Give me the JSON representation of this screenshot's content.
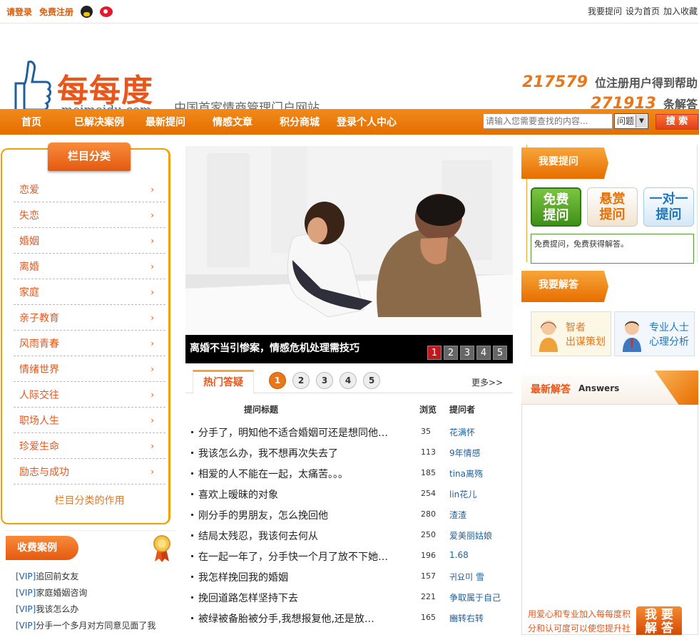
{
  "topbar": {
    "login": "请登录",
    "register": "免费注册",
    "links": [
      "我要提问",
      "设为首页",
      "加入收藏"
    ]
  },
  "header": {
    "logo_cn": "每每度",
    "logo_domain": "meimeidu.com",
    "slogan": "中国首家情商管理门户网站",
    "stat1_num": "217579",
    "stat1_label": "位注册用户得到帮助",
    "stat2_num": "271913",
    "stat2_label": "条解答"
  },
  "nav": {
    "items": [
      "首页",
      "已解决案例",
      "最新提问",
      "情感文章",
      "积分商城",
      "登录个人中心"
    ],
    "search_placeholder": "请输入您需要查找的内容...",
    "select_value": "问题",
    "search_button": "搜 索"
  },
  "sidebar": {
    "title": "栏目分类",
    "categories": [
      "恋爱",
      "失恋",
      "婚姻",
      "离婚",
      "家庭",
      "亲子教育",
      "风雨青春",
      "情绪世界",
      "人际交往",
      "职场人生",
      "珍爱生命",
      "励志与成功"
    ],
    "footer": "栏目分类的作用"
  },
  "paid": {
    "title": "收费案例",
    "items": [
      {
        "tag": "[VIP]",
        "text": "追回前女友"
      },
      {
        "tag": "[VIP]",
        "text": "家庭婚姻咨询"
      },
      {
        "tag": "[VIP]",
        "text": "我该怎么办"
      },
      {
        "tag": "[VIP]",
        "text": "分手一个多月对方同意见面了我"
      }
    ]
  },
  "banner": {
    "caption": "离婚不当引惨案，情感危机处理需技巧",
    "pages": [
      "1",
      "2",
      "3",
      "4",
      "5"
    ],
    "active_page": "1"
  },
  "hot": {
    "title": "热门答疑",
    "pages": [
      "1",
      "2",
      "3",
      "4",
      "5"
    ],
    "more": "更多>>",
    "columns": [
      "提问标题",
      "浏览",
      "提问者"
    ],
    "rows": [
      {
        "q": "分手了，明知他不适合婚姻可还是想同他…",
        "v": "35",
        "u": "花满怀"
      },
      {
        "q": "我该怎么办，我不想再次失去了",
        "v": "113",
        "u": "9年情感"
      },
      {
        "q": "相爱的人不能在一起，太痛苦。。。",
        "v": "185",
        "u": "tina离殇"
      },
      {
        "q": "喜欢上暧昧的对象",
        "v": "254",
        "u": "lin花儿"
      },
      {
        "q": "刚分手的男朋友，怎么挽回他",
        "v": "280",
        "u": "渣渣"
      },
      {
        "q": "结局太残忍，我该何去何从",
        "v": "250",
        "u": "爱美丽姑娘"
      },
      {
        "q": "在一起一年了，分手快一个月了放不下她…",
        "v": "196",
        "u": "1.68"
      },
      {
        "q": "我怎样挽回我的婚姻",
        "v": "157",
        "u": "귀요미 雪"
      },
      {
        "q": "挽回道路怎样坚持下去",
        "v": "221",
        "u": "争取属于自己"
      },
      {
        "q": "被绿被备胎被分手,我想报复他,还是放…",
        "v": "165",
        "u": "豳转右转"
      }
    ]
  },
  "ask": {
    "tab": "我要提问",
    "buttons": [
      {
        "line1": "免费",
        "line2": "提问"
      },
      {
        "line1": "悬赏",
        "line2": "提问"
      },
      {
        "line1": "一对一",
        "line2": "提问"
      }
    ],
    "note": "免费提问，免费获得解答。"
  },
  "answer": {
    "tab": "我要解答",
    "cards": [
      {
        "line1": "智者",
        "line2": "出谋策划"
      },
      {
        "line1": "专业人士",
        "line2": "心理分析"
      }
    ]
  },
  "latest": {
    "title": "最新解答",
    "subtitle": "Answers",
    "promo": "用爱心和专业加入每每度积分和认可度可以使您提升社",
    "promo_button_line1": "我 要",
    "promo_button_line2": "解 答"
  }
}
